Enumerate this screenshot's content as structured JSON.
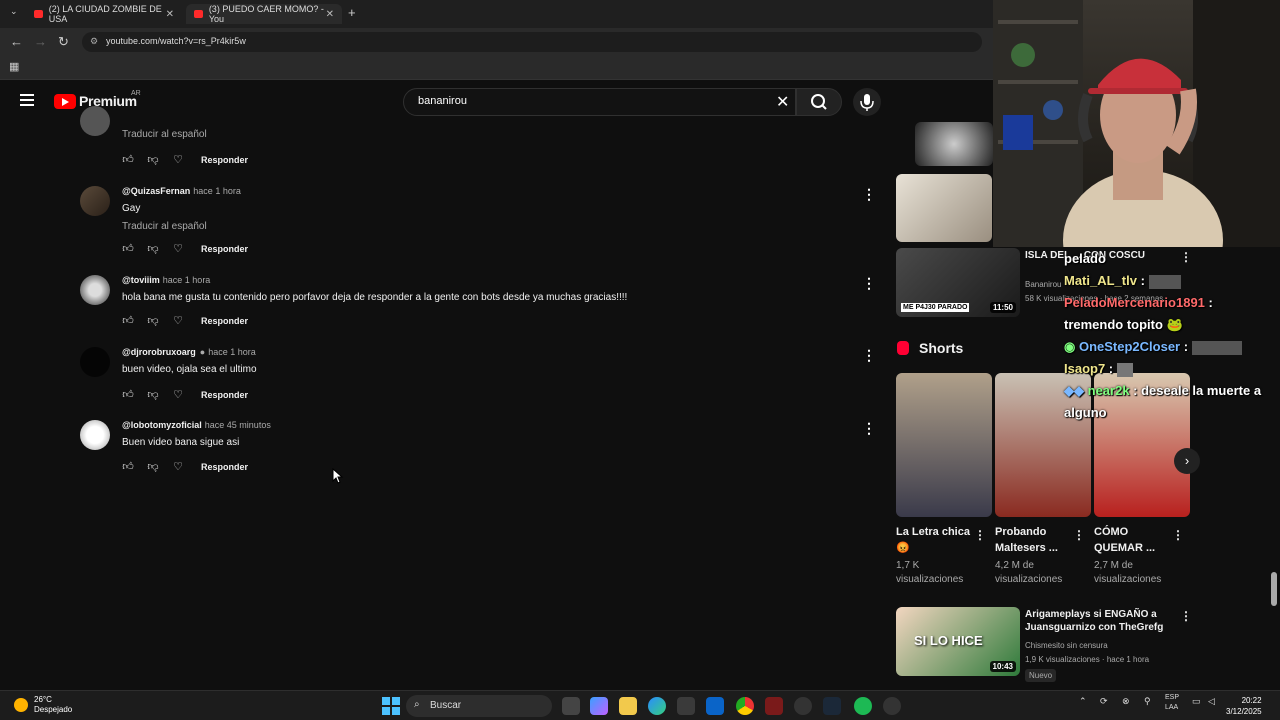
{
  "browser": {
    "tabs": [
      {
        "label": "(2) LA CIUDAD ZOMBIE DE USA"
      },
      {
        "label": "(3) PUEDO CAER MOMO? - You"
      }
    ],
    "url": "youtube.com/watch?v=rs_Pr4kir5w"
  },
  "header": {
    "brand": "Premium",
    "region": "AR",
    "search_value": "bananirou"
  },
  "comments": [
    {
      "handle": "",
      "time": "",
      "text": "",
      "translate": "Traducir al español",
      "reply": "Responder"
    },
    {
      "handle": "@QuizasFernan",
      "time": "hace 1 hora",
      "text": "Gay",
      "translate": "Traducir al español",
      "reply": "Responder"
    },
    {
      "handle": "@toviiim",
      "time": "hace 1 hora",
      "text": "hola bana me gusta tu contenido pero porfavor deja de responder a la gente con bots desde ya muchas gracias!!!!",
      "translate": "",
      "reply": "Responder"
    },
    {
      "handle": "@djrorobruxoarg",
      "time": "hace 1 hora",
      "text": "buen video, ojala sea el ultimo",
      "translate": "",
      "reply": "Responder",
      "verified": true
    },
    {
      "handle": "@lobotomyzoficial",
      "time": "hace 45 minutos",
      "text": "Buen video bana sigue asi",
      "translate": "",
      "reply": "Responder"
    }
  ],
  "sidebar": {
    "video1": {
      "title": "ISLA DEL ... CON COSCU",
      "channel": "Bananirou",
      "meta": "58 K visualizaciones · hace 2 semanas",
      "duration": "11:50",
      "thumb_text": "ME P4J30 PARADO"
    },
    "shorts_header": "Shorts",
    "shorts": [
      {
        "title": "La Letra chica 😡",
        "views": "1,7 K visualizaciones"
      },
      {
        "title": "Probando Maltesers ...",
        "views": "4,2 M de visualizaciones"
      },
      {
        "title": "CÓMO QUEMAR ...",
        "views": "2,7 M de visualizaciones"
      }
    ],
    "video2": {
      "title": "Arigameplays si ENGAÑO a Juansguarnizo con TheGrefg",
      "channel": "Chismesito sin censura",
      "meta": "1,9 K visualizaciones · hace 1 hora",
      "badge": "Nuevo",
      "duration": "10:43",
      "thumb_text": "SI LO HICE"
    }
  },
  "chat": [
    {
      "name": "",
      "text": "pelado"
    },
    {
      "name": "Mati_AL_tlv",
      "text": ""
    },
    {
      "name": "PeladoMercenario1891",
      "text": "tremendo topito 🐸"
    },
    {
      "name": "OneStep2Closer",
      "text": ""
    },
    {
      "name": "Isaop7",
      "text": ""
    },
    {
      "name": "near2k",
      "text": "deseale la muerte a alguno"
    }
  ],
  "taskbar": {
    "temp": "26°C",
    "weather": "Despejado",
    "search": "Buscar",
    "lang1": "ESP",
    "lang2": "LAA",
    "time": "20:22",
    "date": "3/12/2025"
  }
}
